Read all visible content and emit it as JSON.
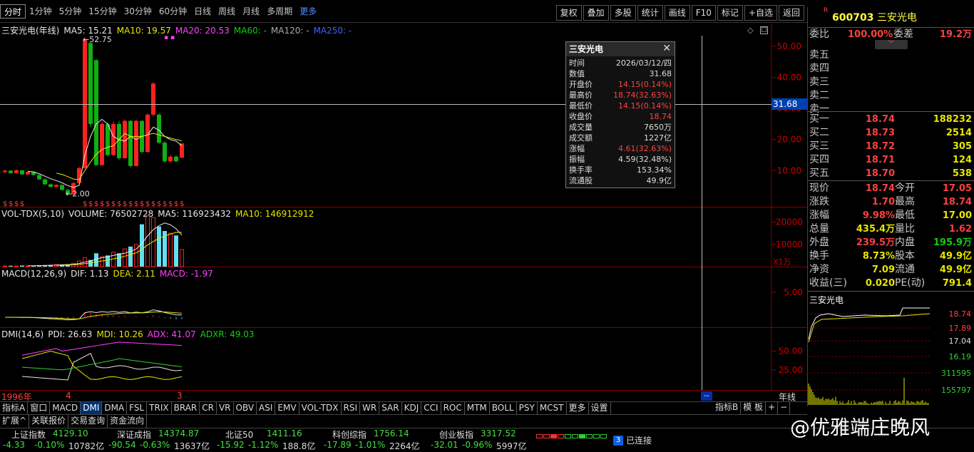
{
  "periods": [
    "分时",
    "1分钟",
    "5分钟",
    "15分钟",
    "30分钟",
    "60分钟",
    "日线",
    "周线",
    "月线",
    "多周期",
    "更多"
  ],
  "tools": [
    "复权",
    "叠加",
    "多股",
    "统计",
    "画线",
    "F10",
    "标记",
    "+自选",
    "返回"
  ],
  "stock": {
    "title": "三安光电(年线)",
    "code": "600703",
    "name": "三安光电",
    "r_tag": "R"
  },
  "ma": {
    "ma5": "MA5: 15.21",
    "ma10": "MA10: 19.57",
    "ma20": "MA20: 20.53",
    "ma60": "MA60: -",
    "ma120": "MA120: -",
    "ma250": "MA250: -"
  },
  "main_axis": [
    "50.00",
    "40.00",
    "30.00",
    "20.00",
    "10.00"
  ],
  "cursor_price": "31.68",
  "high_label": "52.75",
  "low_label": "2.00",
  "vol": {
    "title": "VOL-TDX(5,10)",
    "volume": "VOLUME: 76502728",
    "ma5": "MA5: 116923432",
    "ma10": "MA10: 146912912",
    "axis": [
      "20000",
      "10000"
    ],
    "unit": "X1万"
  },
  "macd": {
    "title": "MACD(12,26,9)",
    "dif": "DIF: 1.13",
    "dea": "DEA: 2.11",
    "macd": "MACD: -1.97",
    "axis": [
      "5.00"
    ]
  },
  "dmi": {
    "title": "DMI(14,6)",
    "pdi": "PDI: 26.63",
    "mdi": "MDI: 10.26",
    "adx": "ADX: 41.07",
    "adxr": "ADXR: 49.03",
    "axis": [
      "50.00",
      "25.00"
    ]
  },
  "xaxis": {
    "start": "1996年",
    "mark1": "4",
    "mark2": "3",
    "label": "年线"
  },
  "tooltip": {
    "title": "三安光电",
    "rows": [
      {
        "k": "时间",
        "v": "2026/03/12/四",
        "c": "#ddd"
      },
      {
        "k": "数值",
        "v": "31.68",
        "c": "#ddd"
      },
      {
        "k": "开盘价",
        "v": "14.15(0.14%)",
        "c": "#ff4040"
      },
      {
        "k": "最高价",
        "v": "18.74(32.63%)",
        "c": "#ff4040"
      },
      {
        "k": "最低价",
        "v": "14.15(0.14%)",
        "c": "#ff4040"
      },
      {
        "k": "收盘价",
        "v": "18.74",
        "c": "#ff4040"
      },
      {
        "k": "成交量",
        "v": "7650万",
        "c": "#ddd"
      },
      {
        "k": "成交额",
        "v": "1227亿",
        "c": "#ddd"
      },
      {
        "k": "涨幅",
        "v": "4.61(32.63%)",
        "c": "#ff4040"
      },
      {
        "k": "振幅",
        "v": "4.59(32.48%)",
        "c": "#ddd"
      },
      {
        "k": "换手率",
        "v": "153.34%",
        "c": "#ddd"
      },
      {
        "k": "流通股",
        "v": "49.9亿",
        "c": "#ddd"
      }
    ]
  },
  "quote": {
    "weibi_label": "委比",
    "weibi": "100.00%",
    "weicha_label": "委差",
    "weicha": "19.2万",
    "sells": [
      "卖五",
      "卖四",
      "卖三",
      "卖二",
      "卖一"
    ],
    "buys": [
      {
        "l": "买一",
        "p": "18.74",
        "v": "188232"
      },
      {
        "l": "买二",
        "p": "18.73",
        "v": "2514"
      },
      {
        "l": "买三",
        "p": "18.72",
        "v": "305"
      },
      {
        "l": "买四",
        "p": "18.71",
        "v": "124"
      },
      {
        "l": "买五",
        "p": "18.70",
        "v": "538"
      }
    ],
    "stats": [
      [
        {
          "l": "现价",
          "v": "18.74",
          "c": "#ff4040"
        },
        {
          "l": "今开",
          "v": "17.05",
          "c": "#ff4040"
        }
      ],
      [
        {
          "l": "涨跌",
          "v": "1.70",
          "c": "#ff4040"
        },
        {
          "l": "最高",
          "v": "18.74",
          "c": "#ff4040"
        }
      ],
      [
        {
          "l": "涨幅",
          "v": "9.98%",
          "c": "#ff4040"
        },
        {
          "l": "最低",
          "v": "17.00",
          "c": "#e6e600"
        }
      ],
      [
        {
          "l": "总量",
          "v": "435.4万",
          "c": "#e6e600"
        },
        {
          "l": "量比",
          "v": "1.62",
          "c": "#ff4040"
        }
      ],
      [
        {
          "l": "外盘",
          "v": "239.5万",
          "c": "#ff4040"
        },
        {
          "l": "内盘",
          "v": "195.9万",
          "c": "#10d010"
        }
      ],
      [
        {
          "l": "换手",
          "v": "8.73%",
          "c": "#e6e600"
        },
        {
          "l": "股本",
          "v": "49.9亿",
          "c": "#e6e600"
        }
      ],
      [
        {
          "l": "净资",
          "v": "7.09",
          "c": "#e6e600"
        },
        {
          "l": "流通",
          "v": "49.9亿",
          "c": "#e6e600"
        }
      ],
      [
        {
          "l": "收益(三)",
          "v": "0.020",
          "c": "#e6e600"
        },
        {
          "l": "PE(动)",
          "v": "791.4",
          "c": "#e6e600"
        }
      ]
    ]
  },
  "mini": {
    "title": "三安光电",
    "axis": [
      "18.74",
      "17.89",
      "17.04",
      "16.19",
      "311595",
      "155797"
    ]
  },
  "btabs": [
    "指标A",
    "窗口",
    "MACD",
    "DMI",
    "DMA",
    "FSL",
    "TRIX",
    "BRAR",
    "CR",
    "VR",
    "OBV",
    "ASI",
    "EMV",
    "VOL-TDX",
    "RSI",
    "WR",
    "SAR",
    "KDJ",
    "CCI",
    "ROC",
    "MTM",
    "BOLL",
    "PSY",
    "MCST",
    "更多",
    "设置"
  ],
  "btabs_right": [
    "指标B",
    "模 板",
    "+",
    "−"
  ],
  "tabs2": [
    "扩展^",
    "关联报价",
    "交易查询",
    "资金流向"
  ],
  "indices": [
    {
      "n": "上证指数",
      "v": "4129.10",
      "c1": "-4.33",
      "c2": "-0.10%",
      "a": "10782亿"
    },
    {
      "n": "深证成指",
      "v": "14374.87",
      "c1": "-90.54",
      "c2": "-0.63%",
      "a": "13637亿"
    },
    {
      "n": "北证50",
      "v": "1411.16",
      "c1": "-15.92",
      "c2": "-1.12%",
      "a": "188.8亿"
    },
    {
      "n": "科创综指",
      "v": "1756.14",
      "c1": "-17.89",
      "c2": "-1.01%",
      "a": "2264亿"
    },
    {
      "n": "创业板指",
      "v": "3317.52",
      "c1": "-32.01",
      "c2": "-0.96%",
      "a": "5997亿"
    }
  ],
  "connection": {
    "count": "3",
    "text": "已连接"
  },
  "watermark": "@优雅端庄晚风",
  "chart_data": {
    "type": "candlestick",
    "title": "三安光电(年线)",
    "candles": [
      {
        "o": 9.5,
        "c": 10.0,
        "h": 10.4,
        "l": 9.3
      },
      {
        "o": 10.0,
        "c": 9.2,
        "h": 10.2,
        "l": 9.0
      },
      {
        "o": 9.2,
        "c": 10.1,
        "h": 10.5,
        "l": 9.0
      },
      {
        "o": 10.1,
        "c": 8.8,
        "h": 10.3,
        "l": 8.6
      },
      {
        "o": 8.8,
        "c": 9.6,
        "h": 9.9,
        "l": 8.6
      },
      {
        "o": 9.6,
        "c": 8.6,
        "h": 9.8,
        "l": 8.3
      },
      {
        "o": 8.6,
        "c": 7.2,
        "h": 8.8,
        "l": 7.0
      },
      {
        "o": 7.2,
        "c": 5.6,
        "h": 7.5,
        "l": 5.4
      },
      {
        "o": 5.6,
        "c": 4.8,
        "h": 5.9,
        "l": 4.5
      },
      {
        "o": 4.8,
        "c": 5.4,
        "h": 5.7,
        "l": 4.6
      },
      {
        "o": 5.4,
        "c": 3.8,
        "h": 5.6,
        "l": 3.6
      },
      {
        "o": 3.8,
        "c": 2.4,
        "h": 4.1,
        "l": 2.0
      },
      {
        "o": 2.4,
        "c": 6.0,
        "h": 6.4,
        "l": 2.3
      },
      {
        "o": 6.0,
        "c": 10.8,
        "h": 11.2,
        "l": 5.8
      },
      {
        "o": 10.8,
        "c": 52.0,
        "h": 52.75,
        "l": 10.5
      },
      {
        "o": 51.0,
        "c": 25.0,
        "h": 51.5,
        "l": 24.0
      },
      {
        "o": 45.5,
        "c": 11.8,
        "h": 46.0,
        "l": 11.5
      },
      {
        "o": 11.8,
        "c": 25.0,
        "h": 25.8,
        "l": 11.5
      },
      {
        "o": 25.0,
        "c": 15.0,
        "h": 25.5,
        "l": 14.5
      },
      {
        "o": 15.0,
        "c": 25.0,
        "h": 25.8,
        "l": 14.8
      },
      {
        "o": 25.0,
        "c": 14.0,
        "h": 26.0,
        "l": 13.5
      },
      {
        "o": 14.0,
        "c": 26.0,
        "h": 26.5,
        "l": 13.8
      },
      {
        "o": 26.0,
        "c": 11.5,
        "h": 26.3,
        "l": 11.0
      },
      {
        "o": 11.5,
        "c": 26.0,
        "h": 26.5,
        "l": 11.3
      },
      {
        "o": 26.0,
        "c": 16.0,
        "h": 26.2,
        "l": 15.5
      },
      {
        "o": 16.0,
        "c": 28.0,
        "h": 28.5,
        "l": 15.8
      },
      {
        "o": 28.0,
        "c": 38.0,
        "h": 38.5,
        "l": 27.5
      },
      {
        "o": 28.0,
        "c": 19.0,
        "h": 28.5,
        "l": 18.5
      },
      {
        "o": 19.0,
        "c": 13.0,
        "h": 19.5,
        "l": 12.5
      },
      {
        "o": 13.0,
        "c": 14.5,
        "h": 15.0,
        "l": 12.5
      },
      {
        "o": 14.5,
        "c": 13.0,
        "h": 15.0,
        "l": 12.8
      },
      {
        "o": 14.15,
        "c": 18.74,
        "h": 18.74,
        "l": 14.15
      }
    ],
    "ma5": [
      null,
      null,
      null,
      null,
      9.8,
      9.6,
      9.0,
      8.2,
      7.4,
      6.8,
      6.1,
      5.2,
      4.6,
      5.3,
      15.0,
      21.0,
      25.0,
      26.5,
      25.0,
      21.0,
      20.0,
      19.5,
      21.0,
      20.0,
      21.0,
      21.5,
      24.0,
      23.0,
      21.0,
      20.0,
      19.5,
      18.0
    ],
    "ma10": [
      null,
      null,
      null,
      null,
      null,
      null,
      null,
      null,
      null,
      9.2,
      8.8,
      8.1,
      7.3,
      7.1,
      10.0,
      12.8,
      15.3,
      16.8,
      17.5,
      18.0,
      20.0,
      22.0,
      21.0,
      21.0,
      21.0,
      21.5,
      22.0,
      21.5,
      21.0,
      20.5,
      20.0,
      19.6
    ],
    "volume": [
      0.3,
      0.4,
      0.3,
      0.5,
      0.4,
      0.5,
      0.6,
      0.7,
      0.8,
      0.9,
      1.0,
      1.1,
      1.5,
      2.5,
      4.0,
      3.0,
      6.0,
      4.5,
      5.0,
      6.5,
      6.0,
      8.0,
      9.0,
      10.0,
      19.0,
      23.0,
      22.0,
      18.0,
      16.0,
      15.0,
      14.0,
      7.65
    ],
    "vol_axis_unit": "X1万",
    "ylim": [
      0,
      55
    ]
  }
}
